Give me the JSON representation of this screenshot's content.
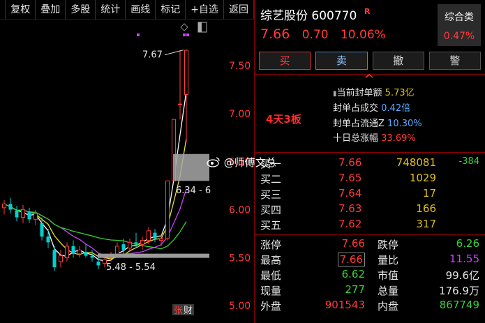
{
  "toolbar": {
    "items": [
      "",
      "复权",
      "叠加",
      "多股",
      "统计",
      "画线",
      "标记",
      "+自选",
      "返回"
    ]
  },
  "chart_data": {
    "type": "candlestick",
    "y_ticks": [
      "7.50",
      "7.00",
      "6.50",
      "6.00",
      "5.50",
      "5.00"
    ],
    "ylim": [
      4.82,
      7.98
    ],
    "annotations": {
      "high_label": "7.67",
      "low_label": "5.48 - 5.54",
      "box_label": "6.34 - 6",
      "badge": "张",
      "badge2": "财"
    },
    "candles": [
      {
        "o": 6.02,
        "h": 6.1,
        "l": 5.95,
        "c": 6.06
      },
      {
        "o": 6.06,
        "h": 6.12,
        "l": 5.96,
        "c": 6.0
      },
      {
        "o": 5.99,
        "h": 6.04,
        "l": 5.88,
        "c": 5.92
      },
      {
        "o": 5.92,
        "h": 6.05,
        "l": 5.86,
        "c": 6.0
      },
      {
        "o": 5.98,
        "h": 6.02,
        "l": 5.86,
        "c": 5.9
      },
      {
        "o": 5.9,
        "h": 6.0,
        "l": 5.84,
        "c": 5.96
      },
      {
        "o": 5.86,
        "h": 5.92,
        "l": 5.68,
        "c": 5.72
      },
      {
        "o": 5.72,
        "h": 5.8,
        "l": 5.6,
        "c": 5.66
      },
      {
        "o": 5.58,
        "h": 5.62,
        "l": 5.36,
        "c": 5.4
      },
      {
        "o": 5.46,
        "h": 5.58,
        "l": 5.4,
        "c": 5.52
      },
      {
        "o": 5.5,
        "h": 5.66,
        "l": 5.46,
        "c": 5.62
      },
      {
        "o": 5.62,
        "h": 5.68,
        "l": 5.5,
        "c": 5.54
      },
      {
        "o": 5.54,
        "h": 5.62,
        "l": 5.5,
        "c": 5.58
      },
      {
        "o": 5.56,
        "h": 5.64,
        "l": 5.5,
        "c": 5.52
      },
      {
        "o": 5.52,
        "h": 5.58,
        "l": 5.46,
        "c": 5.5
      },
      {
        "o": 5.46,
        "h": 5.52,
        "l": 5.38,
        "c": 5.42
      },
      {
        "o": 5.44,
        "h": 5.52,
        "l": 5.4,
        "c": 5.48
      },
      {
        "o": 5.5,
        "h": 5.56,
        "l": 5.46,
        "c": 5.52
      },
      {
        "o": 5.52,
        "h": 5.66,
        "l": 5.5,
        "c": 5.62
      },
      {
        "o": 5.64,
        "h": 5.7,
        "l": 5.54,
        "c": 5.58
      },
      {
        "o": 5.6,
        "h": 5.7,
        "l": 5.56,
        "c": 5.66
      },
      {
        "o": 5.66,
        "h": 5.76,
        "l": 5.6,
        "c": 5.64
      },
      {
        "o": 5.64,
        "h": 5.72,
        "l": 5.58,
        "c": 5.68
      },
      {
        "o": 5.68,
        "h": 5.82,
        "l": 5.64,
        "c": 5.78
      },
      {
        "o": 5.76,
        "h": 5.8,
        "l": 5.66,
        "c": 5.7
      },
      {
        "o": 5.68,
        "h": 5.74,
        "l": 5.62,
        "c": 5.7
      },
      {
        "o": 5.7,
        "h": 6.3,
        "l": 5.68,
        "c": 6.3
      },
      {
        "o": 6.3,
        "h": 6.94,
        "l": 6.3,
        "c": 6.94
      },
      {
        "o": 7.1,
        "h": 7.66,
        "l": 6.94,
        "c": 7.1
      },
      {
        "o": 7.2,
        "h": 7.67,
        "l": 6.7,
        "c": 7.66
      }
    ]
  },
  "stock": {
    "name": "综艺股份",
    "code": "600770",
    "tag": "R",
    "price": "7.66",
    "change": "0.70",
    "change_pct": "10.06%"
  },
  "sector": {
    "name": "综合类",
    "pct": "0.47%"
  },
  "actions": {
    "buy": "买",
    "sell": "卖",
    "cancel": "撤",
    "alert": "警"
  },
  "seal_info": {
    "boards": "4天3板",
    "rows": [
      {
        "label": "当前封单额",
        "value": "5.73亿"
      },
      {
        "label": "封单占成交",
        "value": "0.42倍"
      },
      {
        "label": "封单占流通Z",
        "value": "10.30%"
      },
      {
        "label": "十日总涨幅",
        "value": "33.69%"
      }
    ]
  },
  "orderbook": [
    {
      "label": "买一",
      "price": "7.66",
      "vol": "748081",
      "chg": "-384"
    },
    {
      "label": "买二",
      "price": "7.65",
      "vol": "1029",
      "chg": ""
    },
    {
      "label": "买三",
      "price": "7.64",
      "vol": "17",
      "chg": ""
    },
    {
      "label": "买四",
      "price": "7.63",
      "vol": "166",
      "chg": ""
    },
    {
      "label": "买五",
      "price": "7.62",
      "vol": "317",
      "chg": ""
    }
  ],
  "stats": [
    {
      "l1": "涨停",
      "v1": "7.66",
      "l2": "跌停",
      "v2": "6.26"
    },
    {
      "l1": "最高",
      "v1": "7.66",
      "l2": "量比",
      "v2": "11.55"
    },
    {
      "l1": "最低",
      "v1": "6.62",
      "l2": "市值",
      "v2": "99.6亿"
    },
    {
      "l1": "现量",
      "v1": "277",
      "l2": "总量",
      "v2": "176.9万"
    },
    {
      "l1": "外盘",
      "v1": "901543",
      "l2": "内盘",
      "v2": "867749"
    }
  ],
  "watermark": "@师傅文总",
  "colors": {
    "up": "#ff3b3b",
    "down": "#00d0d0",
    "ma1": "#ffffff",
    "ma2": "#f0e020",
    "ma3": "#d040ff",
    "ma4": "#30d030"
  }
}
